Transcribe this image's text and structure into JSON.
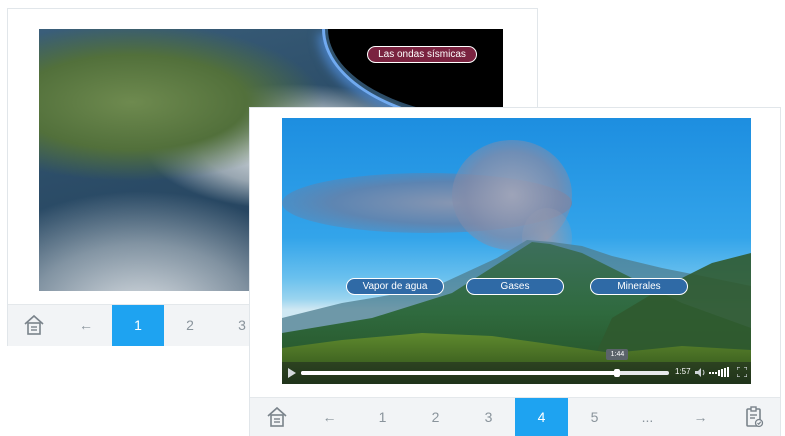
{
  "back_slide": {
    "hotspot_label": "Las ondas sísmicas",
    "nav": {
      "pages": [
        "1",
        "2",
        "3"
      ],
      "active_page": "1",
      "prev_arrow": "←"
    }
  },
  "front_slide": {
    "hotspots": [
      "Vapor de agua",
      "Gases",
      "Minerales"
    ],
    "video": {
      "tooltip_time": "1:44",
      "duration": "1:57",
      "progress": 0.86
    },
    "nav": {
      "prev_arrow": "←",
      "pages": [
        "1",
        "2",
        "3",
        "4",
        "5"
      ],
      "ellipsis": "...",
      "next_arrow": "→",
      "active_page": "4"
    }
  },
  "colors": {
    "accent": "#1ea3f1",
    "hotspot_dark": "#7a2340",
    "hotspot_blue": "#2f6aa6"
  },
  "icons": [
    "home-icon",
    "clipboard-check-icon",
    "play-icon",
    "volume-icon",
    "fullscreen-icon"
  ]
}
